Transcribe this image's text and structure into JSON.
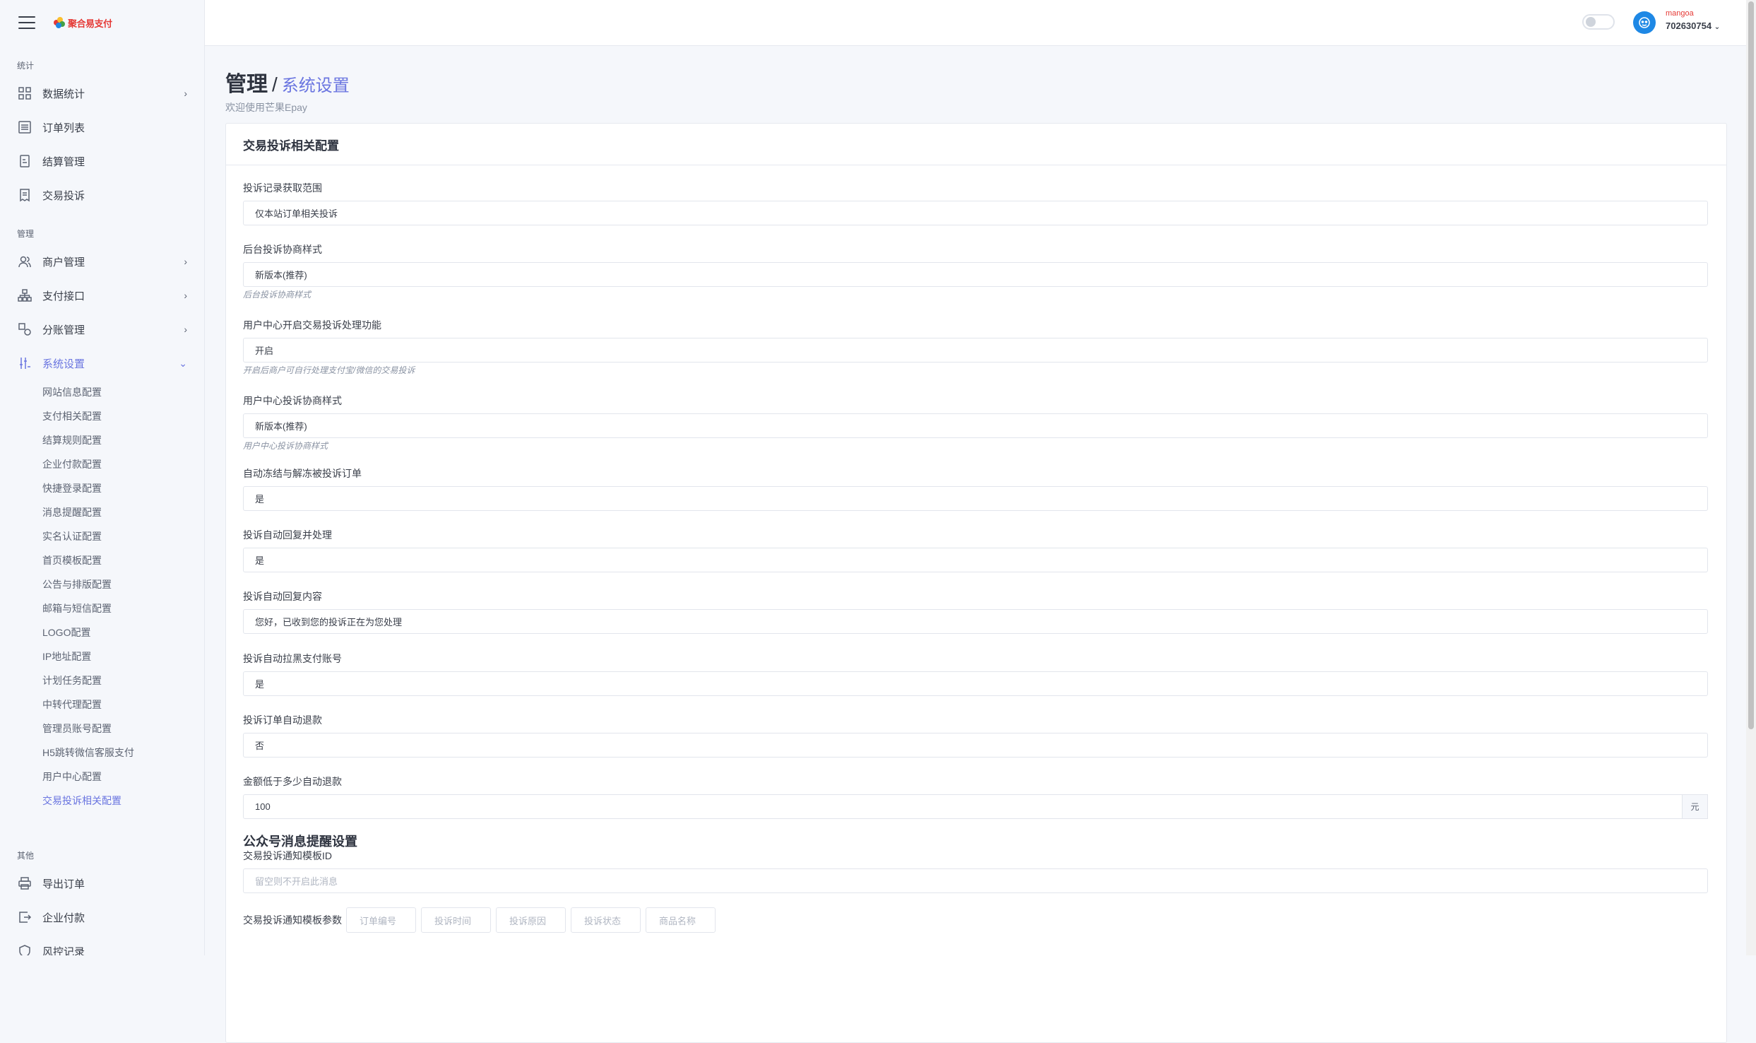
{
  "brand": {
    "logo_text": "聚合易支付"
  },
  "user": {
    "name": "mangoa",
    "id": "702630754"
  },
  "sidebar": {
    "sections": {
      "stats": "统计",
      "manage": "管理",
      "other": "其他"
    },
    "stats_items": [
      {
        "label": "数据统计",
        "icon": "dashboard-grid-icon"
      },
      {
        "label": "订单列表",
        "icon": "list-icon"
      },
      {
        "label": "结算管理",
        "icon": "document-icon"
      },
      {
        "label": "交易投诉",
        "icon": "receipt-icon"
      }
    ],
    "manage_items": [
      {
        "label": "商户管理",
        "icon": "users-icon"
      },
      {
        "label": "支付接口",
        "icon": "sitemap-icon"
      },
      {
        "label": "分账管理",
        "icon": "shapes-icon"
      },
      {
        "label": "系统设置",
        "icon": "sliders-icon"
      }
    ],
    "settings_sub": [
      "网站信息配置",
      "支付相关配置",
      "结算规则配置",
      "企业付款配置",
      "快捷登录配置",
      "消息提醒配置",
      "实名认证配置",
      "首页模板配置",
      "公告与排版配置",
      "邮箱与短信配置",
      "LOGO配置",
      "IP地址配置",
      "计划任务配置",
      "中转代理配置",
      "管理员账号配置",
      "H5跳转微信客服支付",
      "用户中心配置",
      "交易投诉相关配置"
    ],
    "other_items": [
      {
        "label": "导出订单",
        "icon": "printer-icon"
      },
      {
        "label": "企业付款",
        "icon": "export-icon"
      },
      {
        "label": "风控记录",
        "icon": "shield-icon"
      }
    ]
  },
  "page": {
    "title": "管理",
    "separator": "/",
    "subtitle_title": "系统设置",
    "welcome": "欢迎使用芒果Epay"
  },
  "card": {
    "title": "交易投诉相关配置",
    "fields": [
      {
        "label": "投诉记录获取范围",
        "value": "仅本站订单相关投诉",
        "hint": ""
      },
      {
        "label": "后台投诉协商样式",
        "value": "新版本(推荐)",
        "hint": "后台投诉协商样式"
      },
      {
        "label": "用户中心开启交易投诉处理功能",
        "value": "开启",
        "hint": "开启后商户可自行处理支付宝/微信的交易投诉"
      },
      {
        "label": "用户中心投诉协商样式",
        "value": "新版本(推荐)",
        "hint": "用户中心投诉协商样式"
      },
      {
        "label": "自动冻结与解冻被投诉订单",
        "value": "是",
        "hint": ""
      },
      {
        "label": "投诉自动回复并处理",
        "value": "是",
        "hint": ""
      },
      {
        "label": "投诉自动回复内容",
        "value": "您好，已收到您的投诉正在为您处理",
        "hint": ""
      },
      {
        "label": "投诉自动拉黑支付账号",
        "value": "是",
        "hint": ""
      },
      {
        "label": "投诉订单自动退款",
        "value": "否",
        "hint": ""
      }
    ],
    "refund_threshold": {
      "label": "金额低于多少自动退款",
      "value": "100",
      "unit": "元"
    },
    "wechat_section": "公众号消息提醒设置",
    "template_id": {
      "label": "交易投诉通知模板ID",
      "placeholder": "留空则不开启此消息"
    },
    "template_params": {
      "label": "交易投诉通知模板参数",
      "chips": [
        "订单编号",
        "投诉时间",
        "投诉原因",
        "投诉状态",
        "商品名称"
      ]
    }
  }
}
